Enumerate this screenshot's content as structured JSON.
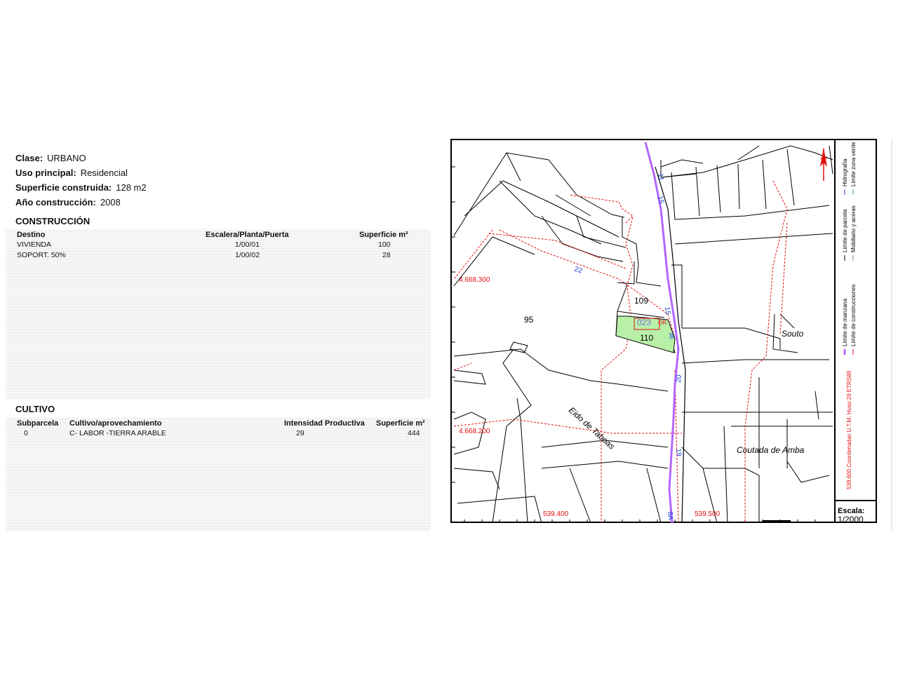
{
  "info": {
    "clase_label": "Clase:",
    "clase_value": "URBANO",
    "uso_label": "Uso principal:",
    "uso_value": "Residencial",
    "superficie_label": "Superficie construida:",
    "superficie_value": "128 m2",
    "anio_label": "Año construcción:",
    "anio_value": "2008"
  },
  "construccion": {
    "title": "CONSTRUCCIÓN",
    "headers": [
      "Destino",
      "Escalera/Planta/Puerta",
      "Superficie m²"
    ],
    "rows": [
      [
        "VIVIENDA",
        "1/00/01",
        "100"
      ],
      [
        "SOPORT. 50%",
        "1/00/02",
        "28"
      ]
    ]
  },
  "cultivo": {
    "title": "CULTIVO",
    "headers": [
      "Subparcela",
      "Cultivo/aprovechamiento",
      "Intensidad Productiva",
      "Superficie m²"
    ],
    "rows": [
      [
        "0",
        "C- LABOR -TIERRA ARABLE",
        "29",
        "444"
      ]
    ]
  },
  "map": {
    "parcel_labels": [
      "109",
      "95",
      "110",
      "023"
    ],
    "place_names": [
      "Souto",
      "Eido de Taboas",
      "Coutada de Amba"
    ],
    "coords_y": [
      "4.668.300",
      "4.668.200"
    ],
    "coords_x": [
      "539.400",
      "539.500"
    ],
    "street_numbers": [
      "22",
      "15",
      "11",
      "15",
      "20",
      "19",
      "8A",
      "36",
      "OR"
    ],
    "legend": [
      "Límite de manzana",
      "Límite de parcela",
      "Hidrografía",
      "Límite de construcciones",
      "Mobiliario y aceras",
      "Límite zona verde"
    ],
    "coord_note": "539.600 Coordenadas U.T.M. Huso 29 ETRS89",
    "scale_label": "Escala:",
    "scale_value": "1/2000",
    "colors": {
      "highlight": "#b9f0a8",
      "hydro": "#b366ff",
      "coords": "#e01010",
      "street": "#1a3fd6"
    }
  }
}
